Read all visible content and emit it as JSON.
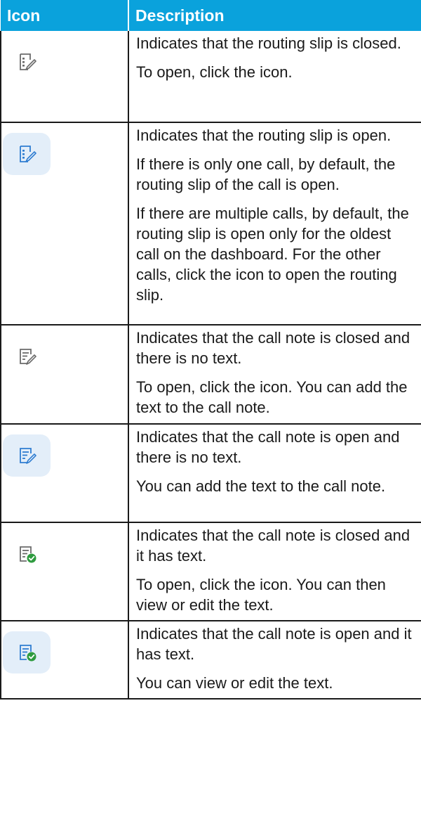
{
  "header": {
    "icon": "Icon",
    "description": "Description"
  },
  "rows": [
    {
      "icon": "routing-slip-closed-icon",
      "active": false,
      "paragraphs": [
        "Indicates that the routing slip is closed.",
        "To open, click the icon."
      ]
    },
    {
      "icon": "routing-slip-open-icon",
      "active": true,
      "paragraphs": [
        "Indicates that the routing slip is open.",
        "If there is only one call, by default, the routing slip of the call is open.",
        "If there are multiple calls, by default, the routing slip is open only for the oldest call on the dashboard. For the other calls, click the icon to open the routing slip."
      ]
    },
    {
      "icon": "call-note-closed-empty-icon",
      "active": false,
      "paragraphs": [
        "Indicates that the call note is closed and there is no text.",
        "To open, click the icon. You can add the text to the call note."
      ]
    },
    {
      "icon": "call-note-open-empty-icon",
      "active": true,
      "paragraphs": [
        "Indicates that the call note is open and there is no text.",
        "You can add the text to the call note."
      ]
    },
    {
      "icon": "call-note-closed-text-icon",
      "active": false,
      "paragraphs": [
        "Indicates that the call note is closed and it has text.",
        "To open, click the icon. You can then view or edit the text."
      ]
    },
    {
      "icon": "call-note-open-text-icon",
      "active": true,
      "paragraphs": [
        "Indicates that the call note is open and it has text.",
        "You can view or edit the text."
      ]
    }
  ],
  "colors": {
    "header_bg": "#0aa2dc",
    "header_text": "#ffffff",
    "border": "#1a1a1a",
    "icon_active_bg": "#e3eef9",
    "check_green": "#2e9b3f"
  }
}
